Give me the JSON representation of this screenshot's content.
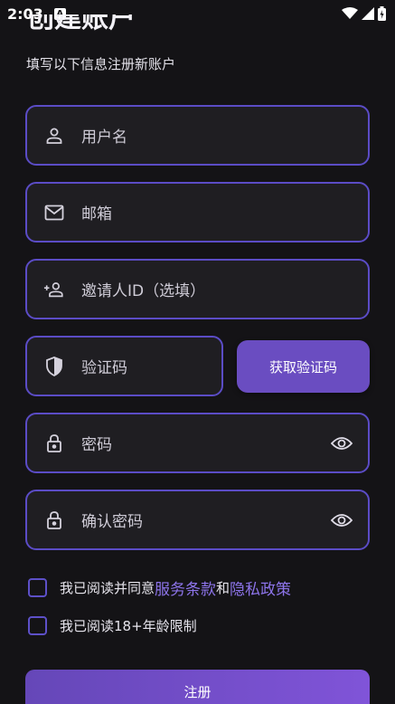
{
  "status_bar": {
    "time": "2:03",
    "notification_letter": "A"
  },
  "header": {
    "title": "创建账户",
    "subtitle": "填写以下信息注册新账户"
  },
  "form": {
    "username": {
      "placeholder": "用户名",
      "icon": "person-icon"
    },
    "email": {
      "placeholder": "邮箱",
      "icon": "mail-icon"
    },
    "invite": {
      "placeholder": "邀请人ID（选填）",
      "icon": "person-add-icon"
    },
    "code": {
      "placeholder": "验证码",
      "icon": "shield-icon"
    },
    "get_code_label": "获取验证码",
    "password": {
      "placeholder": "密码",
      "icon": "lock-icon"
    },
    "confirm_password": {
      "placeholder": "确认密码",
      "icon": "lock-icon"
    }
  },
  "agreements": {
    "terms_prefix": "我已阅读并同意",
    "terms_link": "服务条款",
    "terms_and": "和",
    "privacy_link": "隐私政策",
    "age_label": "我已阅读18+年龄限制"
  },
  "register_label": "注册",
  "colors": {
    "background": "#141316",
    "field_border": "#5b4cc6",
    "accent": "#6a4dc1",
    "link": "#8d74ea"
  }
}
